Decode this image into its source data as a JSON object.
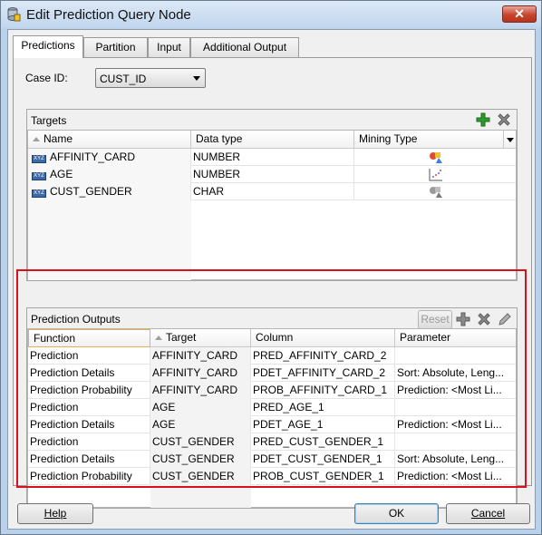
{
  "window": {
    "title": "Edit Prediction Query Node",
    "close_glyph": "✕"
  },
  "tabs": [
    {
      "label": "Predictions",
      "active": true
    },
    {
      "label": "Partition",
      "active": false
    },
    {
      "label": "Input",
      "active": false
    },
    {
      "label": "Additional Output",
      "active": false
    }
  ],
  "case_id": {
    "label": "Case ID:",
    "value": "CUST_ID"
  },
  "targets": {
    "title": "Targets",
    "columns": [
      "Name",
      "Data type",
      "Mining Type"
    ],
    "rows": [
      {
        "name": "AFFINITY_CARD",
        "type": "NUMBER",
        "mining_icon": "classification-icon"
      },
      {
        "name": "AGE",
        "type": "NUMBER",
        "mining_icon": "regression-icon"
      },
      {
        "name": "CUST_GENDER",
        "type": "CHAR",
        "mining_icon": "classification-icon"
      }
    ],
    "type_icon_text": "XYZ"
  },
  "outputs": {
    "title": "Prediction Outputs",
    "reset_label": "Reset",
    "columns": [
      "Function",
      "Target",
      "Column",
      "Parameter"
    ],
    "rows": [
      {
        "function": "Prediction",
        "target": "AFFINITY_CARD",
        "column": "PRED_AFFINITY_CARD_2",
        "parameter": ""
      },
      {
        "function": "Prediction Details",
        "target": "AFFINITY_CARD",
        "column": "PDET_AFFINITY_CARD_2",
        "parameter": "Sort: Absolute, Leng..."
      },
      {
        "function": "Prediction Probability",
        "target": "AFFINITY_CARD",
        "column": "PROB_AFFINITY_CARD_1",
        "parameter": "Prediction: <Most Li..."
      },
      {
        "function": "Prediction",
        "target": "AGE",
        "column": "PRED_AGE_1",
        "parameter": ""
      },
      {
        "function": "Prediction Details",
        "target": "AGE",
        "column": "PDET_AGE_1",
        "parameter": "Prediction: <Most Li..."
      },
      {
        "function": "Prediction",
        "target": "CUST_GENDER",
        "column": "PRED_CUST_GENDER_1",
        "parameter": ""
      },
      {
        "function": "Prediction Details",
        "target": "CUST_GENDER",
        "column": "PDET_CUST_GENDER_1",
        "parameter": "Sort: Absolute, Leng..."
      },
      {
        "function": "Prediction Probability",
        "target": "CUST_GENDER",
        "column": "PROB_CUST_GENDER_1",
        "parameter": "Prediction: <Most Li..."
      }
    ]
  },
  "buttons": {
    "help": "Help",
    "ok": "OK",
    "cancel": "Cancel"
  },
  "colors": {
    "highlight_border": "#d9111a",
    "add_green": "#2e9a2e"
  }
}
